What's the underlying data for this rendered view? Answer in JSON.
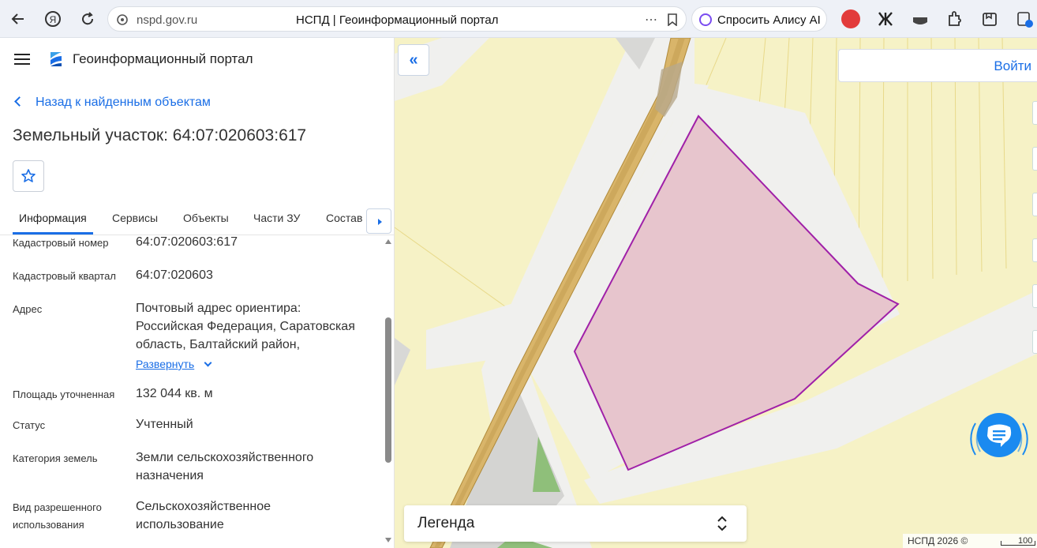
{
  "browser": {
    "url": "nspd.gov.ru",
    "tab_title": "НСПД | Геоинформационный портал",
    "alisa_label": "Спросить Алису AI",
    "ya_label": "Я"
  },
  "header": {
    "app_title": "Геоинформационный портал"
  },
  "nav": {
    "back_label": "Назад к найденным объектам"
  },
  "page": {
    "title": "Земельный участок: 64:07:020603:617"
  },
  "tabs": [
    {
      "label": "Информация"
    },
    {
      "label": "Сервисы"
    },
    {
      "label": "Объекты"
    },
    {
      "label": "Части ЗУ"
    },
    {
      "label": "Состав"
    }
  ],
  "details": {
    "cadastral_number": {
      "label": "Кадастровый номер",
      "value": "64:07:020603:617"
    },
    "cadastral_quarter": {
      "label": "Кадастровый квартал",
      "value": "64:07:020603"
    },
    "address": {
      "label": "Адрес",
      "line1": "Почтовый адрес ориентира:",
      "line2": "Российская Федерация, Саратовская",
      "line3": "область, Балтайский район,",
      "expand_label": "Развернуть"
    },
    "area": {
      "label": "Площадь уточненная",
      "value": "132 044 кв. м"
    },
    "status": {
      "label": "Статус",
      "value": "Учтенный"
    },
    "category": {
      "label": "Категория земель",
      "line1": "Земли сельскохозяйственного",
      "line2": "назначения"
    },
    "permitted_use": {
      "label_line1": "Вид разрешенного",
      "label_line2": "использования",
      "line1": "Сельскохозяйственное",
      "line2": "использование"
    }
  },
  "map": {
    "login_label": "Войти",
    "legend_label": "Легенда",
    "copyright": "НСПД 2026 ©",
    "scale_label": "100",
    "parcel_color": "#a020a8",
    "parcel_fill": "#e7c5cd",
    "field_color": "#f6f2c6",
    "road_color": "#f0f0ee"
  },
  "colors": {
    "accent": "#1a6ee6"
  }
}
